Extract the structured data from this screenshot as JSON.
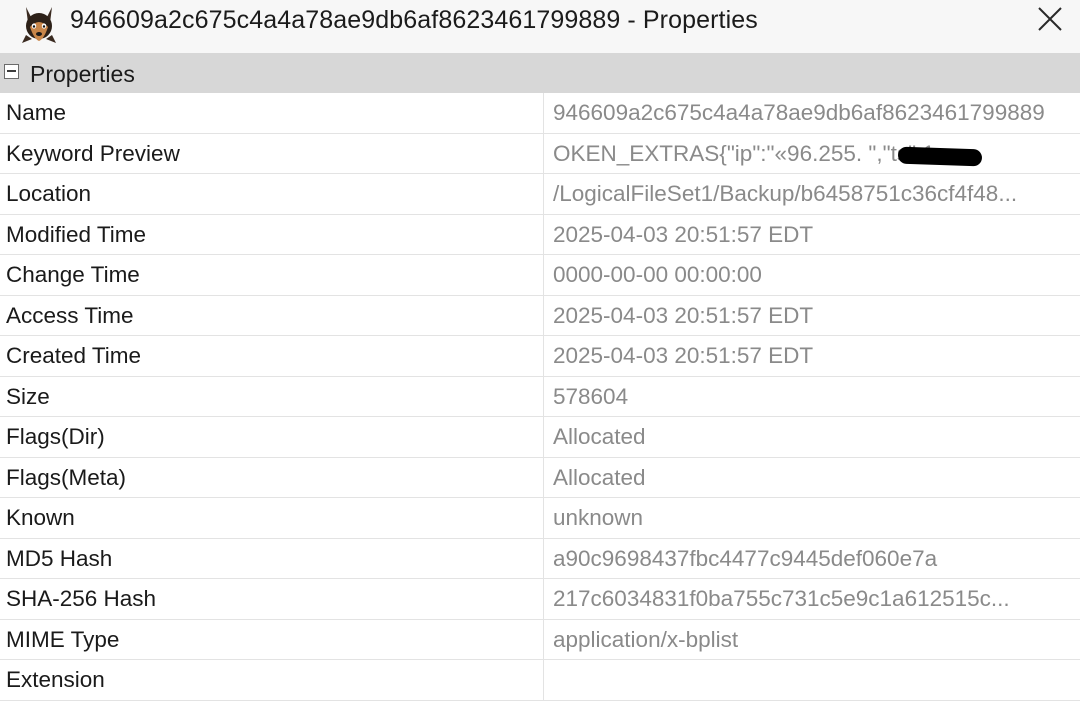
{
  "window": {
    "title": "946609a2c675c4a4a78ae9db6af8623461799889 - Properties",
    "app_icon": "autopsy-dog-icon",
    "close_icon": "close-icon"
  },
  "section": {
    "title": "Properties",
    "toggle_icon": "collapse-minus-icon"
  },
  "properties": [
    {
      "name": "Name",
      "value": "946609a2c675c4a4a78ae9db6af8623461799889"
    },
    {
      "name": "Keyword Preview",
      "value": "OKEN_EXTRAS{\"ip\":\"«96.255.       \",\"ts\":1..."
    },
    {
      "name": "Location",
      "value": "/LogicalFileSet1/Backup/b6458751c36cf4f48..."
    },
    {
      "name": "Modified Time",
      "value": "2025-04-03 20:51:57 EDT"
    },
    {
      "name": "Change Time",
      "value": "0000-00-00 00:00:00"
    },
    {
      "name": "Access Time",
      "value": "2025-04-03 20:51:57 EDT"
    },
    {
      "name": "Created Time",
      "value": "2025-04-03 20:51:57 EDT"
    },
    {
      "name": "Size",
      "value": "578604"
    },
    {
      "name": "Flags(Dir)",
      "value": "Allocated"
    },
    {
      "name": "Flags(Meta)",
      "value": "Allocated"
    },
    {
      "name": "Known",
      "value": "unknown"
    },
    {
      "name": "MD5 Hash",
      "value": "a90c9698437fbc4477c9445def060e7a"
    },
    {
      "name": "SHA-256 Hash",
      "value": "217c6034831f0ba755c731c5e9c1a612515c..."
    },
    {
      "name": "MIME Type",
      "value": "application/x-bplist"
    },
    {
      "name": "Extension",
      "value": ""
    }
  ],
  "colors": {
    "header_bg": "#d7d7d7",
    "title_bg": "#f7f7f7",
    "value_text": "#8a8a8a",
    "name_text": "#1a1a1a",
    "grid_line": "#e3e3e3"
  }
}
